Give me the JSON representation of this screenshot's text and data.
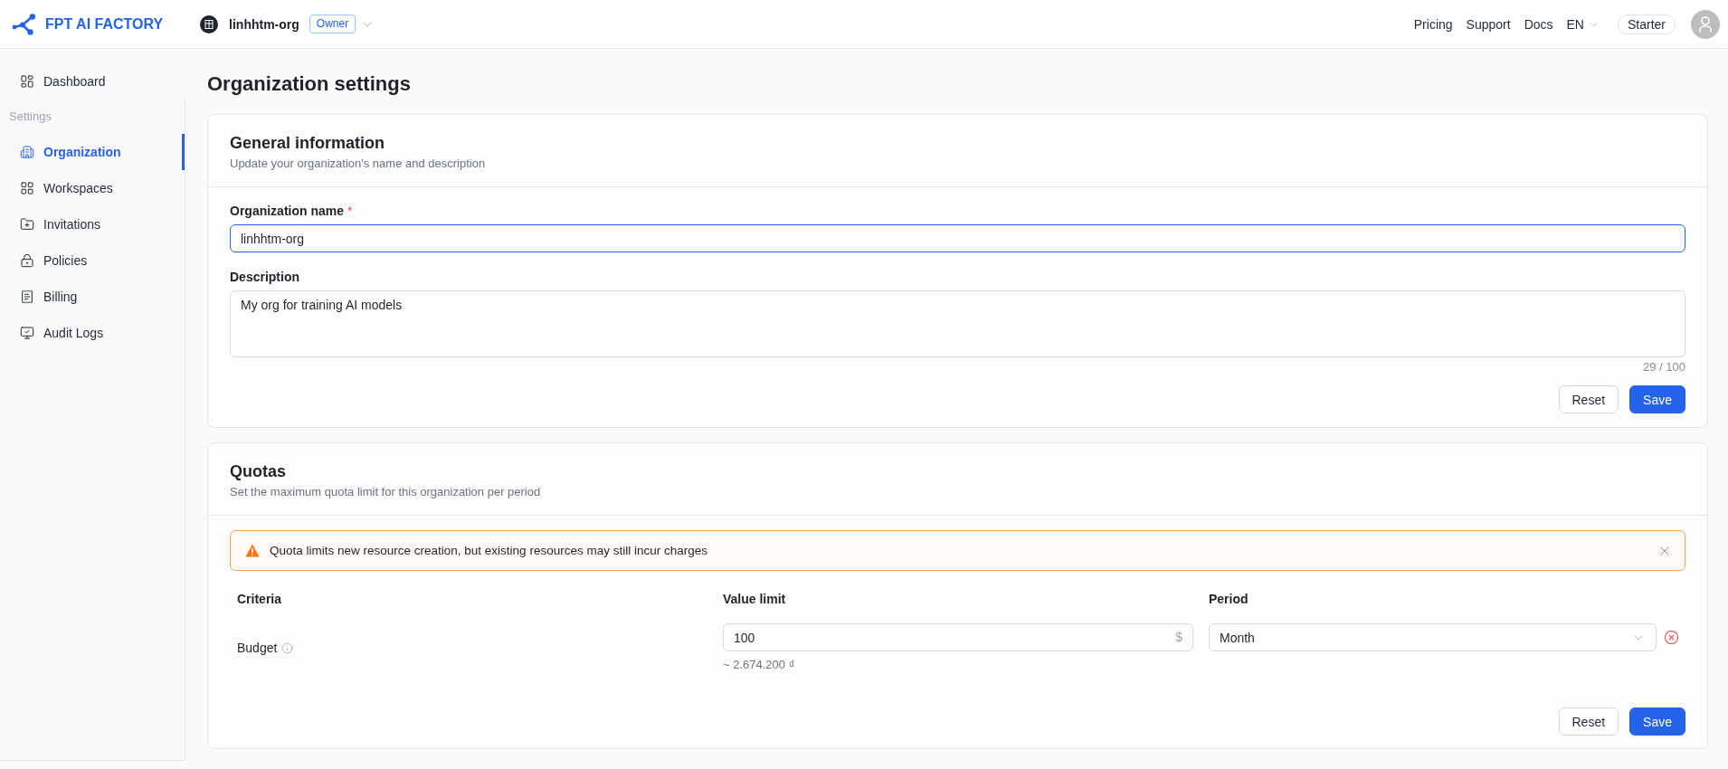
{
  "header": {
    "logo": "FPT AI FACTORY",
    "org_name": "linhhtm-org",
    "role": "Owner",
    "links": [
      "Pricing",
      "Support",
      "Docs"
    ],
    "language": "EN",
    "plan": "Starter"
  },
  "sidebar": {
    "items": [
      {
        "label": "Dashboard",
        "selected": false
      }
    ],
    "section_label": "Settings",
    "section_items": [
      {
        "label": "Organization",
        "selected": true
      },
      {
        "label": "Workspaces",
        "selected": false
      },
      {
        "label": "Invitations",
        "selected": false
      },
      {
        "label": "Policies",
        "selected": false
      },
      {
        "label": "Billing",
        "selected": false
      },
      {
        "label": "Audit Logs",
        "selected": false
      }
    ]
  },
  "page_title": "Organization settings",
  "general": {
    "title": "General information",
    "subtitle": "Update your organization's name and description",
    "fields": [
      {
        "kind": "input",
        "label": "Organization name",
        "required_mark": "*",
        "value": "linhhtm-org",
        "focused": true
      },
      {
        "kind": "textarea",
        "label": "Description",
        "value": "My org for training AI models",
        "counter": "29 / 100",
        "focused": false
      }
    ],
    "buttons": [
      {
        "label": "Reset",
        "kind": "secondary"
      },
      {
        "label": "Save",
        "kind": "primary"
      }
    ]
  },
  "quotas": {
    "title": "Quotas",
    "subtitle": "Set the maximum quota limit for this organization per period",
    "alert": {
      "kind": "warning",
      "text": "Quota limits new resource creation, but existing resources may still incur charges"
    },
    "columns": [
      "Criteria",
      "Value limit",
      "Period"
    ],
    "rows": [
      {
        "criteria": "Budget",
        "value": "100",
        "unit": "$",
        "converted": "~ 2.674.200 ₫",
        "period": "Month"
      }
    ],
    "buttons": [
      {
        "label": "Reset",
        "kind": "secondary"
      },
      {
        "label": "Save",
        "kind": "primary"
      }
    ]
  }
}
